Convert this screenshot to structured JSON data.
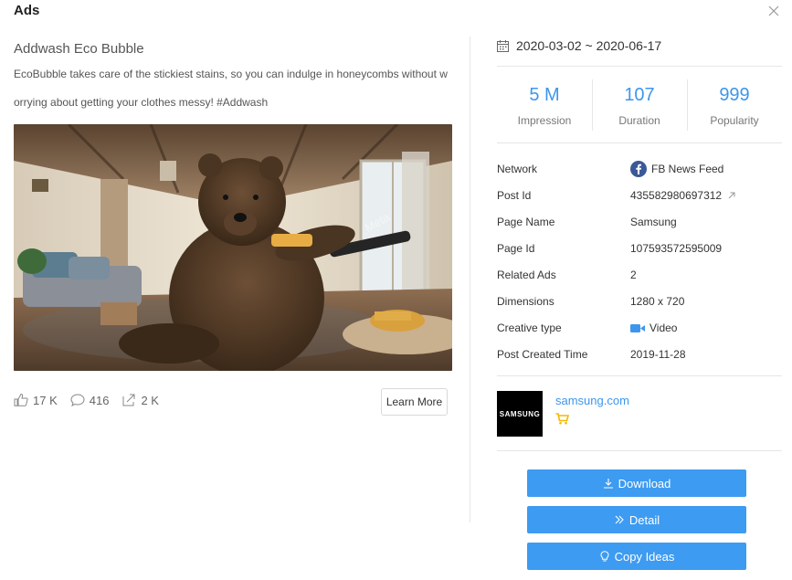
{
  "modal": {
    "title": "Ads"
  },
  "ad": {
    "title": "Addwash Eco Bubble",
    "description": "EcoBubble takes care of the stickiest stains, so you can indulge in honeycombs without worrying about getting your clothes messy! #Addwash"
  },
  "engagement": {
    "likes": "17 K",
    "comments": "416",
    "shares": "2 K"
  },
  "cta": {
    "label": "Learn More"
  },
  "date_range": "2020-03-02 ~ 2020-06-17",
  "metrics": [
    {
      "value": "5 M",
      "label": "Impression"
    },
    {
      "value": "107",
      "label": "Duration"
    },
    {
      "value": "999",
      "label": "Popularity"
    }
  ],
  "info": {
    "network": {
      "key": "Network",
      "value": "FB News Feed"
    },
    "post_id": {
      "key": "Post Id",
      "value": "435582980697312"
    },
    "page_name": {
      "key": "Page Name",
      "value": "Samsung"
    },
    "page_id": {
      "key": "Page Id",
      "value": "107593572595009"
    },
    "related_ads": {
      "key": "Related Ads",
      "value": "2"
    },
    "dimensions": {
      "key": "Dimensions",
      "value": "1280 x 720"
    },
    "creative_type": {
      "key": "Creative type",
      "value": "Video"
    },
    "post_created": {
      "key": "Post Created Time",
      "value": "2019-11-28"
    }
  },
  "advertiser": {
    "logo_text": "SAMSUNG",
    "domain": "samsung.com"
  },
  "actions": {
    "download": "Download",
    "detail": "Detail",
    "copy_ideas": "Copy Ideas"
  },
  "colors": {
    "accent": "#3d96ec",
    "button": "#3d9bf1",
    "facebook": "#3b5998",
    "video": "#3d96ec",
    "cart": "#f5b800"
  },
  "icons": {
    "close": "close-icon",
    "calendar": "calendar-icon",
    "like": "like-icon",
    "comment": "comment-icon",
    "share": "share-icon",
    "facebook": "facebook-icon",
    "external": "external-link-icon",
    "video": "video-icon",
    "cart": "cart-icon",
    "download": "download-icon",
    "detail": "double-chevron-right-icon",
    "bulb": "lightbulb-icon"
  }
}
